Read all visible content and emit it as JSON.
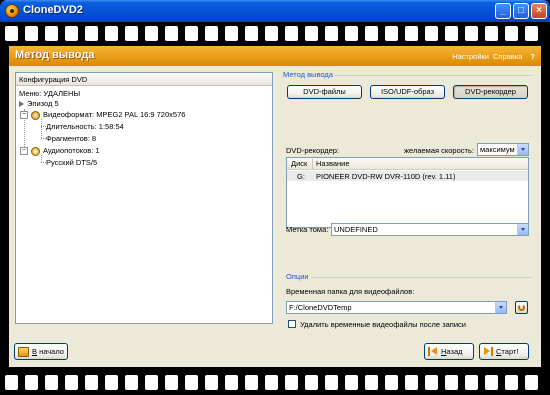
{
  "window": {
    "title": "CloneDVD2"
  },
  "header": {
    "title": "Метод вывода",
    "settings_link": "Настройки",
    "help_link": "Справка",
    "help_q": "?"
  },
  "tree": {
    "header": "Конфигурация DVD",
    "menu": "Меню: УДАЛЕНЫ",
    "episode": "Эпизод 5",
    "video_format": "Видеоформат: MPEG2 PAL 16:9 720x576",
    "duration": "Длительность: 1:58:54",
    "fragments": "Фрагментов: 8",
    "audio_streams": "Аудиопотоков: 1",
    "audio_track": "Русский DTS/5",
    "exp_minus": "−"
  },
  "output_method": {
    "group_label": "Метод вывода",
    "buttons": [
      "DVD-файлы",
      "ISO/UDF-образ",
      "DVD-рекордер"
    ],
    "selected": "DVD-рекордер"
  },
  "recorder": {
    "label": "DVD-рекордер:",
    "speed_label": "желаемая скорость:",
    "speed_value": "максимум",
    "columns": [
      "Диск",
      "Название"
    ],
    "rows": [
      {
        "disk": "G:",
        "name": "PIONEER DVD-RW  DVR-110D (rev. 1.11)"
      }
    ],
    "volume_label": "Метка тома:",
    "volume_value": "UNDEFINED"
  },
  "options": {
    "group_label": "Опции",
    "temp_folder_label": "Временная папка для видеофайлов:",
    "temp_folder_value": "F:/CloneDVDTemp",
    "delete_temp_label": "Удалить временные видеофайлы после записи",
    "delete_temp_checked": false
  },
  "footer": {
    "home_button": "В начало",
    "home_underline": "В",
    "home_rest": " начало",
    "back_button": "Назад",
    "back_underline": "Н",
    "back_rest": "азад",
    "start_button": "Старт!",
    "start_underline": "С",
    "start_rest": "тарт!"
  },
  "colors": {
    "header_orange": "#e79a14",
    "titlebar_blue": "#0553d6",
    "group_label_blue": "#1c5ae0"
  }
}
